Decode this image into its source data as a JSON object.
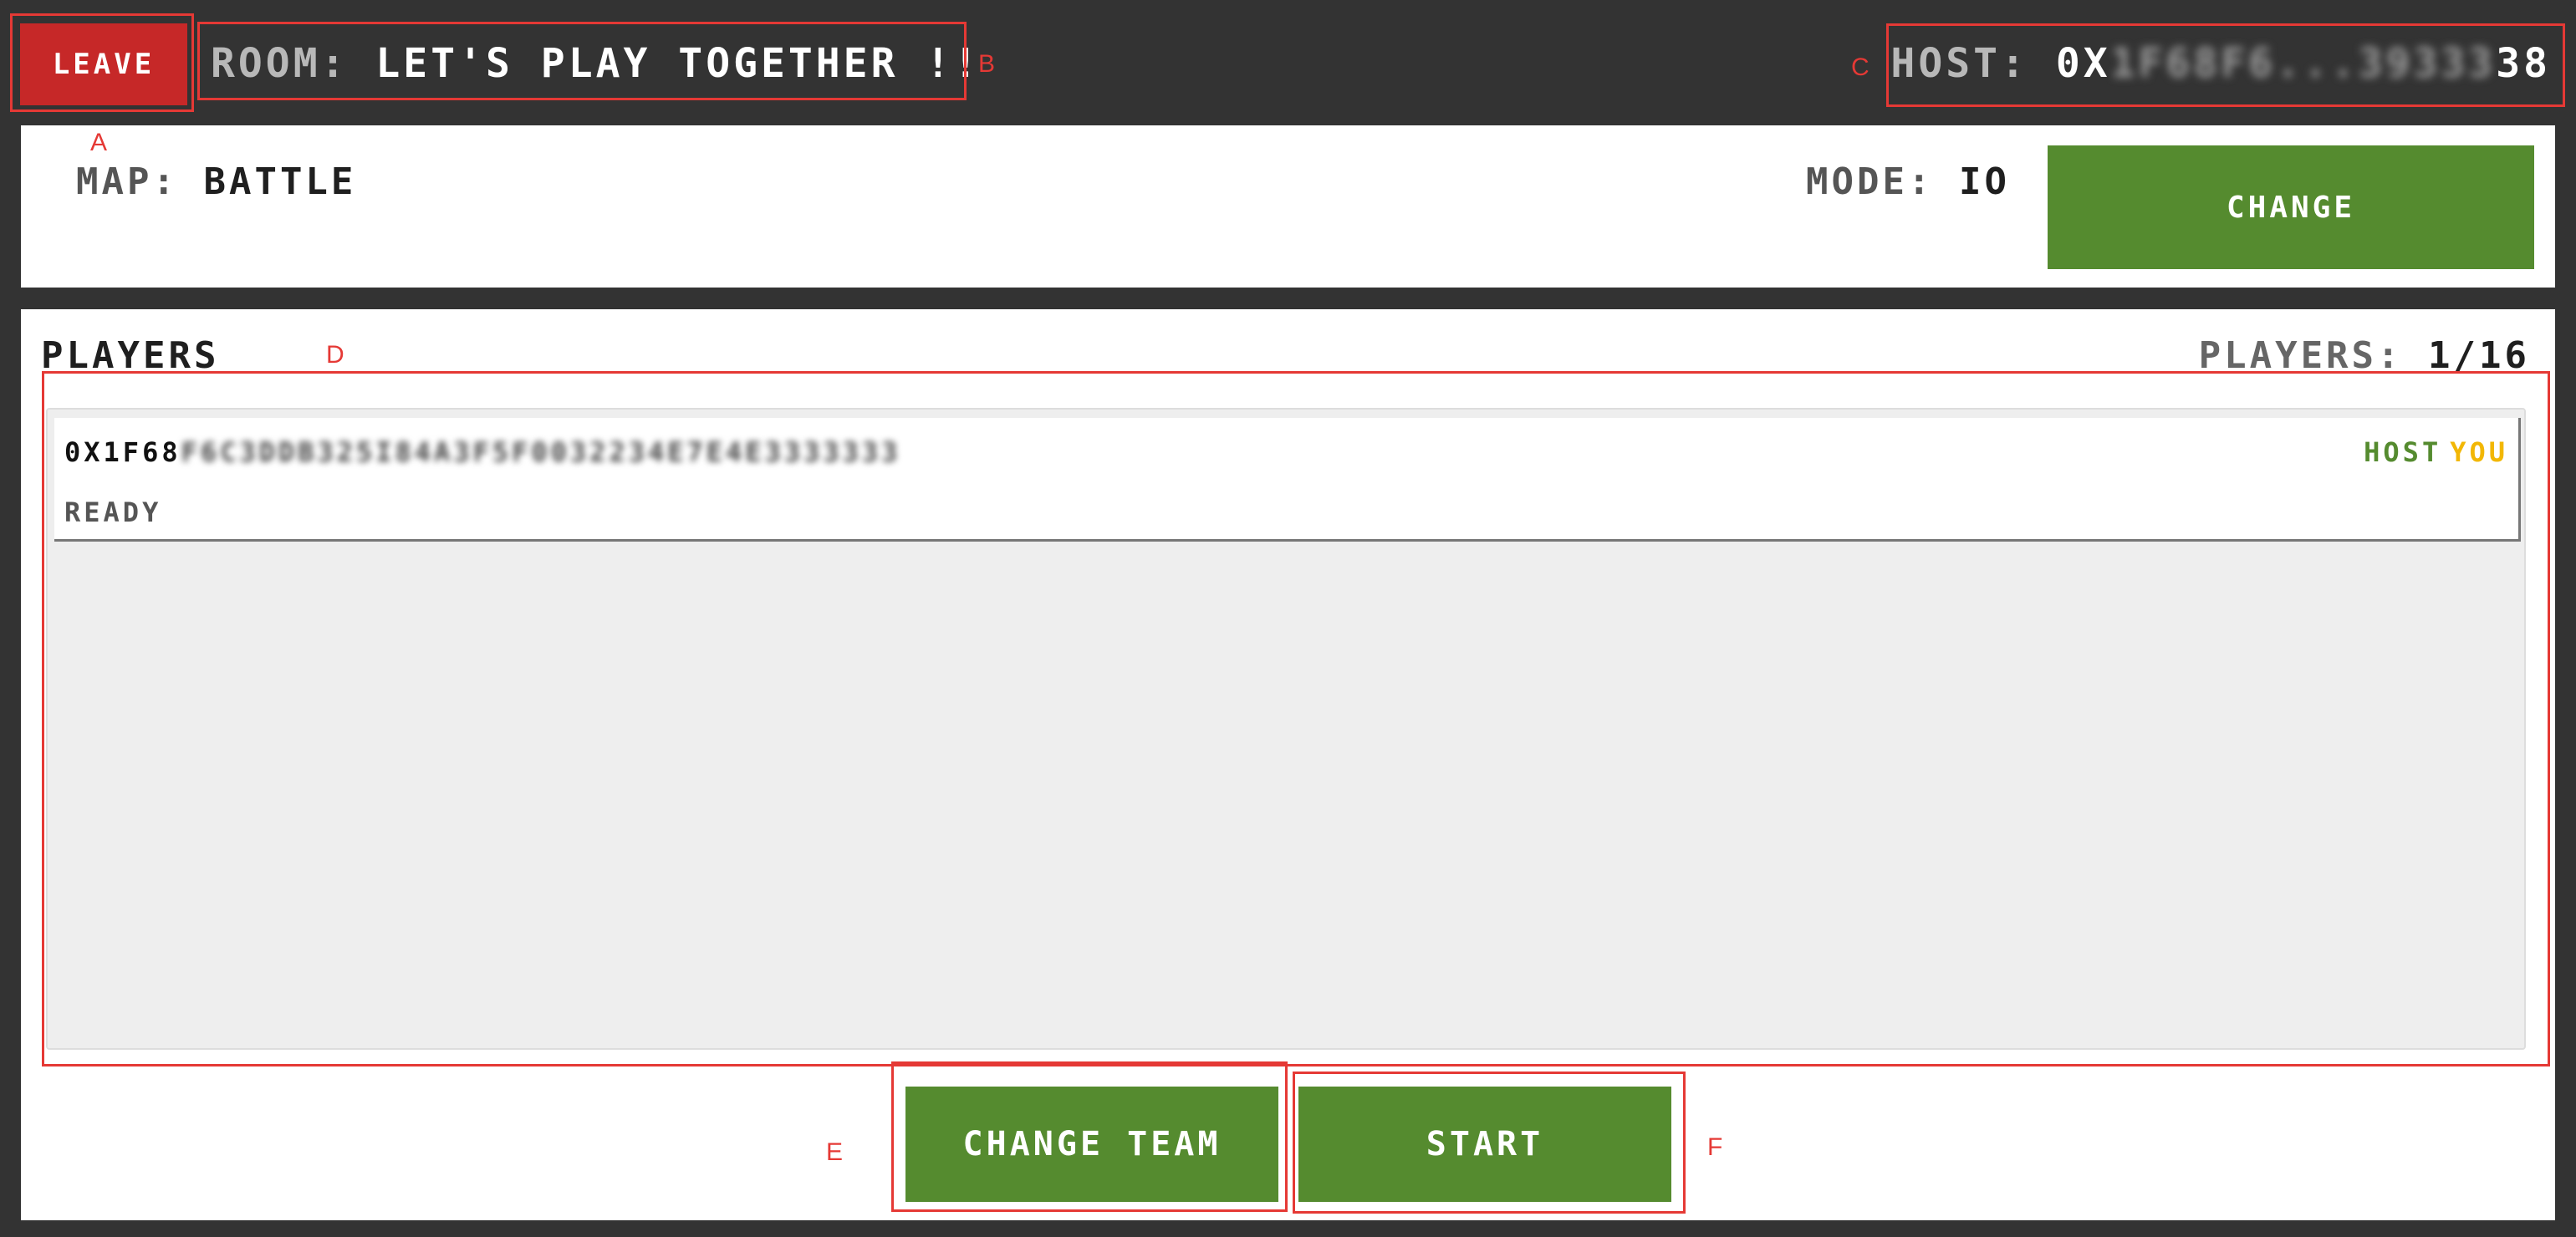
{
  "header": {
    "leave_label": "LEAVE",
    "room_label": "ROOM:",
    "room_name": "LET'S PLAY TOGETHER !!",
    "host_label": "HOST:",
    "host_addr_visible": "0X",
    "host_addr_obscured": "1F68F6...39333",
    "host_addr_tail": "38"
  },
  "map_panel": {
    "map_label": "MAP:",
    "map_value": "BATTLE",
    "mode_label": "MODE:",
    "mode_value": "IO",
    "change_label": "CHANGE"
  },
  "players": {
    "heading": "PLAYERS",
    "count_label": "PLAYERS:",
    "count_value": "1/16",
    "list": [
      {
        "address_visible": "0X1F68",
        "address_obscured": "F6C3DDB325I84A3F5F0032234E7E4E3333333",
        "status": "READY",
        "host_tag": "HOST",
        "you_tag": "YOU"
      }
    ]
  },
  "actions": {
    "change_team_label": "CHANGE TEAM",
    "start_label": "START"
  },
  "annotations": {
    "a": "A",
    "b": "B",
    "c": "C",
    "d": "D",
    "e": "E",
    "f": "F"
  },
  "colors": {
    "background": "#333333",
    "leave_red": "#c62828",
    "action_green": "#558b2f",
    "host_green": "#558b2f",
    "you_yellow": "#f2b705",
    "annotation_red": "#e53935"
  }
}
